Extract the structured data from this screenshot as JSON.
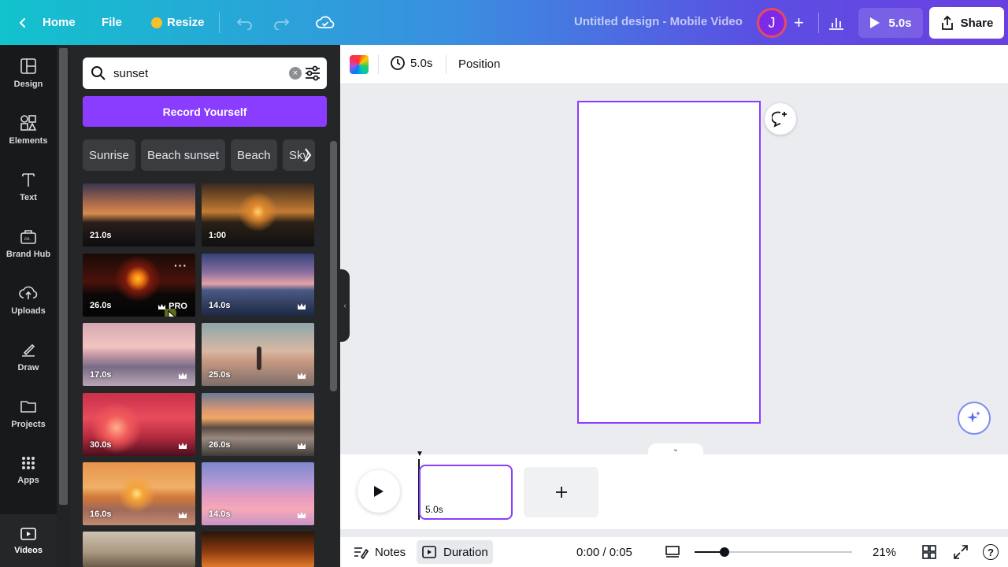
{
  "topbar": {
    "home_label": "Home",
    "file_label": "File",
    "resize_label": "Resize",
    "document_title": "Untitled design - Mobile Video",
    "avatar_initial": "J",
    "play_duration": "5.0s",
    "share_label": "Share"
  },
  "rail": {
    "items": [
      {
        "label": "Design",
        "icon": "design-icon"
      },
      {
        "label": "Elements",
        "icon": "elements-icon"
      },
      {
        "label": "Text",
        "icon": "text-icon"
      },
      {
        "label": "Brand Hub",
        "icon": "brand-hub-icon"
      },
      {
        "label": "Uploads",
        "icon": "upload-cloud-icon"
      },
      {
        "label": "Draw",
        "icon": "draw-icon"
      },
      {
        "label": "Projects",
        "icon": "folder-icon"
      },
      {
        "label": "Apps",
        "icon": "apps-grid-icon"
      },
      {
        "label": "Videos",
        "icon": "video-icon"
      }
    ]
  },
  "panel": {
    "search_value": "sunset",
    "record_label": "Record Yourself",
    "chips": [
      "Sunrise",
      "Beach sunset",
      "Beach",
      "Sky"
    ],
    "videos": [
      {
        "duration": "21.0s",
        "pro": false,
        "crown": false
      },
      {
        "duration": "1:00",
        "pro": false,
        "crown": false
      },
      {
        "duration": "26.0s",
        "pro": true,
        "crown": false,
        "pro_label": "PRO"
      },
      {
        "duration": "14.0s",
        "pro": false,
        "crown": true
      },
      {
        "duration": "17.0s",
        "pro": false,
        "crown": true
      },
      {
        "duration": "25.0s",
        "pro": false,
        "crown": true
      },
      {
        "duration": "30.0s",
        "pro": false,
        "crown": true
      },
      {
        "duration": "26.0s",
        "pro": false,
        "crown": true
      },
      {
        "duration": "16.0s",
        "pro": false,
        "crown": true
      },
      {
        "duration": "14.0s",
        "pro": false,
        "crown": true
      }
    ]
  },
  "context_toolbar": {
    "duration": "5.0s",
    "position_label": "Position"
  },
  "timeline": {
    "clip_duration": "5.0s"
  },
  "bottombar": {
    "notes_label": "Notes",
    "duration_label": "Duration",
    "time_readout": "0:00 / 0:05",
    "zoom_percent": "21%",
    "zoom_fraction": 0.19,
    "help_label": "?"
  },
  "colors": {
    "accent": "#8b3dff",
    "rail_bg": "#18191b",
    "panel_bg": "#252627"
  }
}
